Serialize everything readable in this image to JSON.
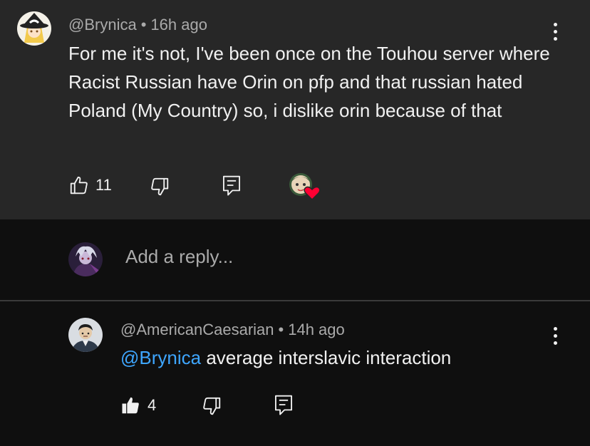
{
  "parent_comment": {
    "author": "@Brynica",
    "time": "16h ago",
    "text": "For me it's not, I've been once on the Touhou server where Racist Russian have Orin on pfp and that russian hated Poland (My Country) so, i dislike orin because of that",
    "like_count": "11",
    "icons": {
      "like": "thumbs-up-outline-icon",
      "dislike": "thumbs-down-outline-icon",
      "reply": "reply-comment-icon",
      "hearted": "creator-heart-badge",
      "menu": "more-vert-icon"
    }
  },
  "reply_box": {
    "placeholder": "Add a reply..."
  },
  "reply_comment": {
    "author": "@AmericanCaesarian",
    "time": "14h ago",
    "mention": "@Brynica",
    "text": " average interslavic interaction",
    "like_count": "4",
    "liked": true,
    "icons": {
      "like": "thumbs-up-filled-icon",
      "dislike": "thumbs-down-outline-icon",
      "reply": "reply-comment-icon",
      "menu": "more-vert-icon"
    }
  },
  "colors": {
    "background": "#0f0f0f",
    "highlight": "#272727",
    "text": "#f1f1f1",
    "meta": "#aaaaaa",
    "mention": "#3ea6ff",
    "heart": "#ff0033"
  }
}
